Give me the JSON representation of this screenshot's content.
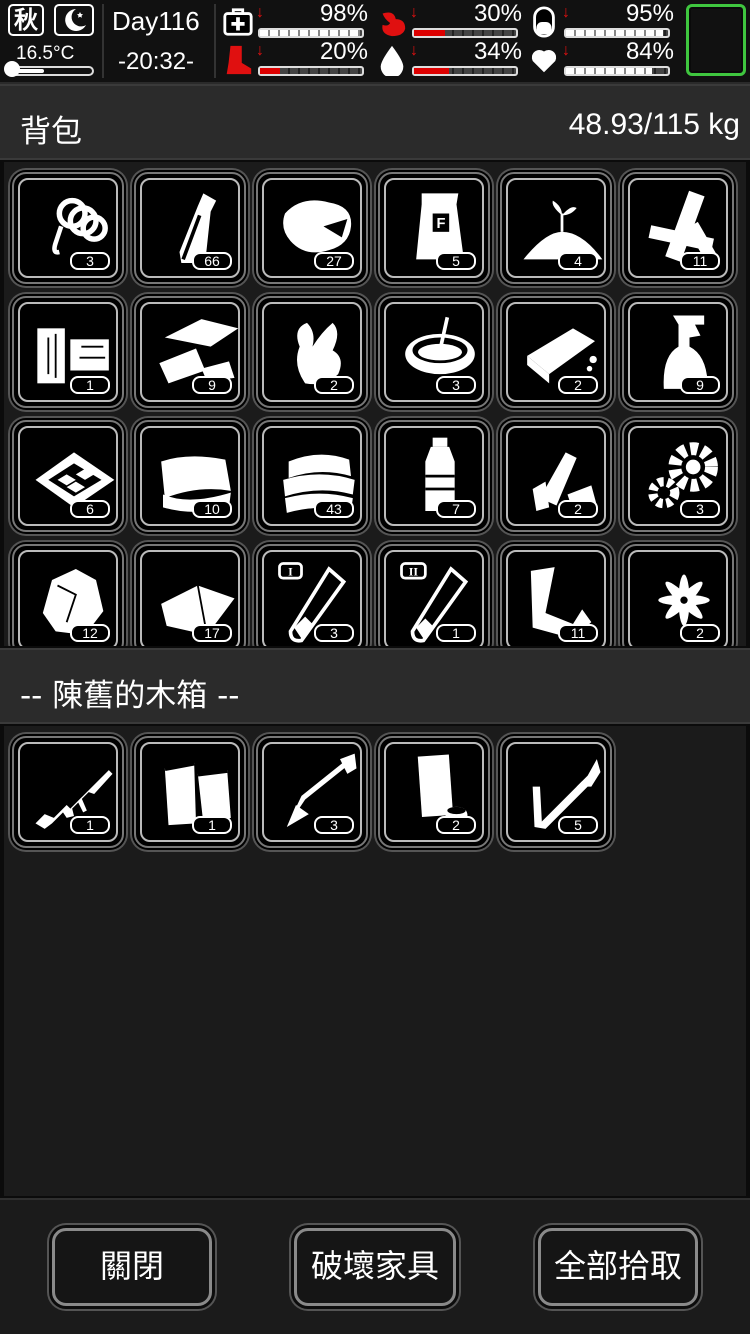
{
  "hud": {
    "season": "秋",
    "temperature": "16.5°C",
    "day": "Day116",
    "time": "-20:32-",
    "stats": [
      {
        "key": "health",
        "icon": "medkit-icon",
        "value": "98%",
        "level": 0.98
      },
      {
        "key": "hunger",
        "icon": "stomach-icon",
        "value": "30%",
        "level": 0.3
      },
      {
        "key": "medicine",
        "icon": "pill-icon",
        "value": "95%",
        "level": 0.95
      },
      {
        "key": "stamina",
        "icon": "leg-icon",
        "value": "20%",
        "level": 0.2
      },
      {
        "key": "thirst",
        "icon": "water-drop-icon",
        "value": "34%",
        "level": 0.34
      },
      {
        "key": "mood",
        "icon": "heart-icon",
        "value": "84%",
        "level": 0.84
      }
    ]
  },
  "backpack": {
    "title": "背包",
    "weight": "48.93/115 kg",
    "items": [
      {
        "icon": "rope-icon",
        "count": "3"
      },
      {
        "icon": "bottle-icon",
        "count": "66"
      },
      {
        "icon": "meat-icon",
        "count": "27"
      },
      {
        "icon": "flour-bag-icon",
        "count": "5"
      },
      {
        "icon": "soil-sprout-icon",
        "count": "4"
      },
      {
        "icon": "wood-planks-icon",
        "count": "11"
      },
      {
        "icon": "wood-blocks-icon",
        "count": "1"
      },
      {
        "icon": "paper-scraps-icon",
        "count": "9"
      },
      {
        "icon": "ginger-root-icon",
        "count": "2"
      },
      {
        "icon": "soup-bowl-icon",
        "count": "3"
      },
      {
        "icon": "soap-bar-icon",
        "count": "2"
      },
      {
        "icon": "spray-bottle-icon",
        "count": "9"
      },
      {
        "icon": "food-tray-icon",
        "count": "6"
      },
      {
        "icon": "cloth-icon",
        "count": "10"
      },
      {
        "icon": "folded-cloth-icon",
        "count": "43"
      },
      {
        "icon": "water-bottle-icon",
        "count": "7"
      },
      {
        "icon": "plastic-trash-icon",
        "count": "2"
      },
      {
        "icon": "gears-icon",
        "count": "3"
      },
      {
        "icon": "stone-icon",
        "count": "12"
      },
      {
        "icon": "leather-icon",
        "count": "17"
      },
      {
        "icon": "test-tube-1-icon",
        "count": "3"
      },
      {
        "icon": "test-tube-2-icon",
        "count": "1"
      },
      {
        "icon": "scrap-metal-icon",
        "count": "11"
      },
      {
        "icon": "flower-icon",
        "count": "2"
      }
    ]
  },
  "container": {
    "title": "-- 陳舊的木箱 --",
    "items": [
      {
        "icon": "rifle-icon",
        "count": "1"
      },
      {
        "icon": "gloves-icon",
        "count": "1"
      },
      {
        "icon": "arrow-icon",
        "count": "3"
      },
      {
        "icon": "can-icon",
        "count": "2"
      },
      {
        "icon": "torch-icon",
        "count": "5"
      }
    ]
  },
  "buttons": {
    "close": "關閉",
    "destroy": "破壞家具",
    "take_all": "全部拾取"
  },
  "colors": {
    "accent_green": "#3fc63f",
    "warning_red": "#e01010"
  }
}
